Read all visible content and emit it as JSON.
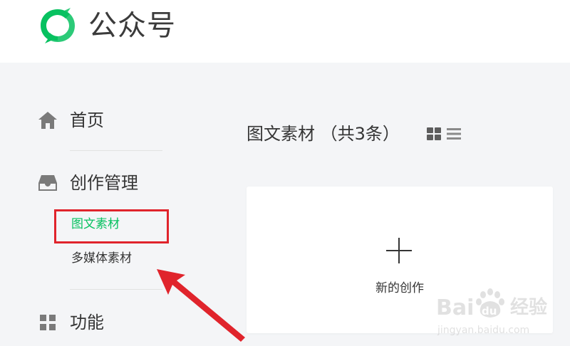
{
  "header": {
    "brand_name": "公众号",
    "brand_color": "#07c160",
    "logo_icon": "wechat-official-logo-icon"
  },
  "sidebar": {
    "items": [
      {
        "label": "首页",
        "icon": "home-icon"
      },
      {
        "label": "创作管理",
        "icon": "inbox-icon"
      },
      {
        "label": "功能",
        "icon": "grid-icon"
      }
    ],
    "sub_items": [
      {
        "label": "图文素材",
        "state": "active"
      },
      {
        "label": "多媒体素材",
        "state": "normal"
      }
    ]
  },
  "main": {
    "title": "图文素材 （共3条）",
    "view_modes": [
      "grid-view-icon",
      "list-view-icon"
    ],
    "new_card": {
      "label": "新的创作",
      "icon": "plus-icon"
    }
  },
  "annotation": {
    "highlight_color": "#e0242c",
    "shapes": [
      "red-highlight-box",
      "red-pointer-arrow"
    ]
  },
  "watermark": {
    "logo": "Bai du 经验",
    "url": "jingyan.baidu.com"
  }
}
